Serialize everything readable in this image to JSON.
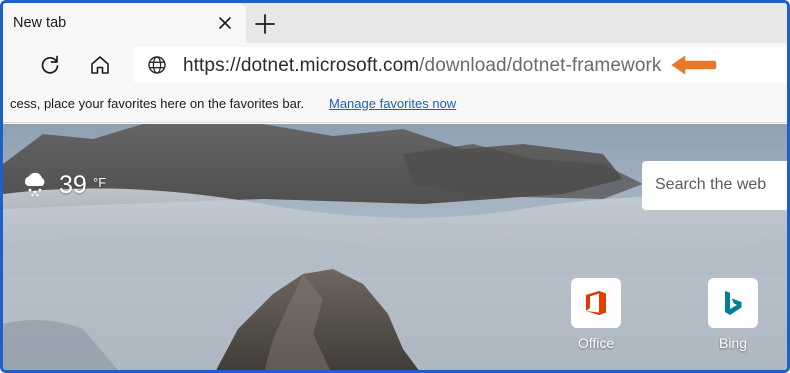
{
  "tab": {
    "title": "New tab"
  },
  "address_bar": {
    "url_host": "https://dotnet.microsoft.com",
    "url_path": "/download/dotnet-framework"
  },
  "favorites_bar": {
    "message": "cess, place your favorites here on the favorites bar.",
    "link": "Manage favorites now"
  },
  "weather": {
    "temperature": "39",
    "unit": "°F",
    "icon": "cloud-snow-icon"
  },
  "search": {
    "placeholder": "Search the web"
  },
  "quick_links": [
    {
      "label": "Office",
      "icon": "office-icon"
    },
    {
      "label": "Bing",
      "icon": "bing-icon"
    }
  ],
  "colors": {
    "frame_border": "#1f5fc8",
    "annotation_arrow": "#e8782a",
    "link": "#1664b8"
  }
}
